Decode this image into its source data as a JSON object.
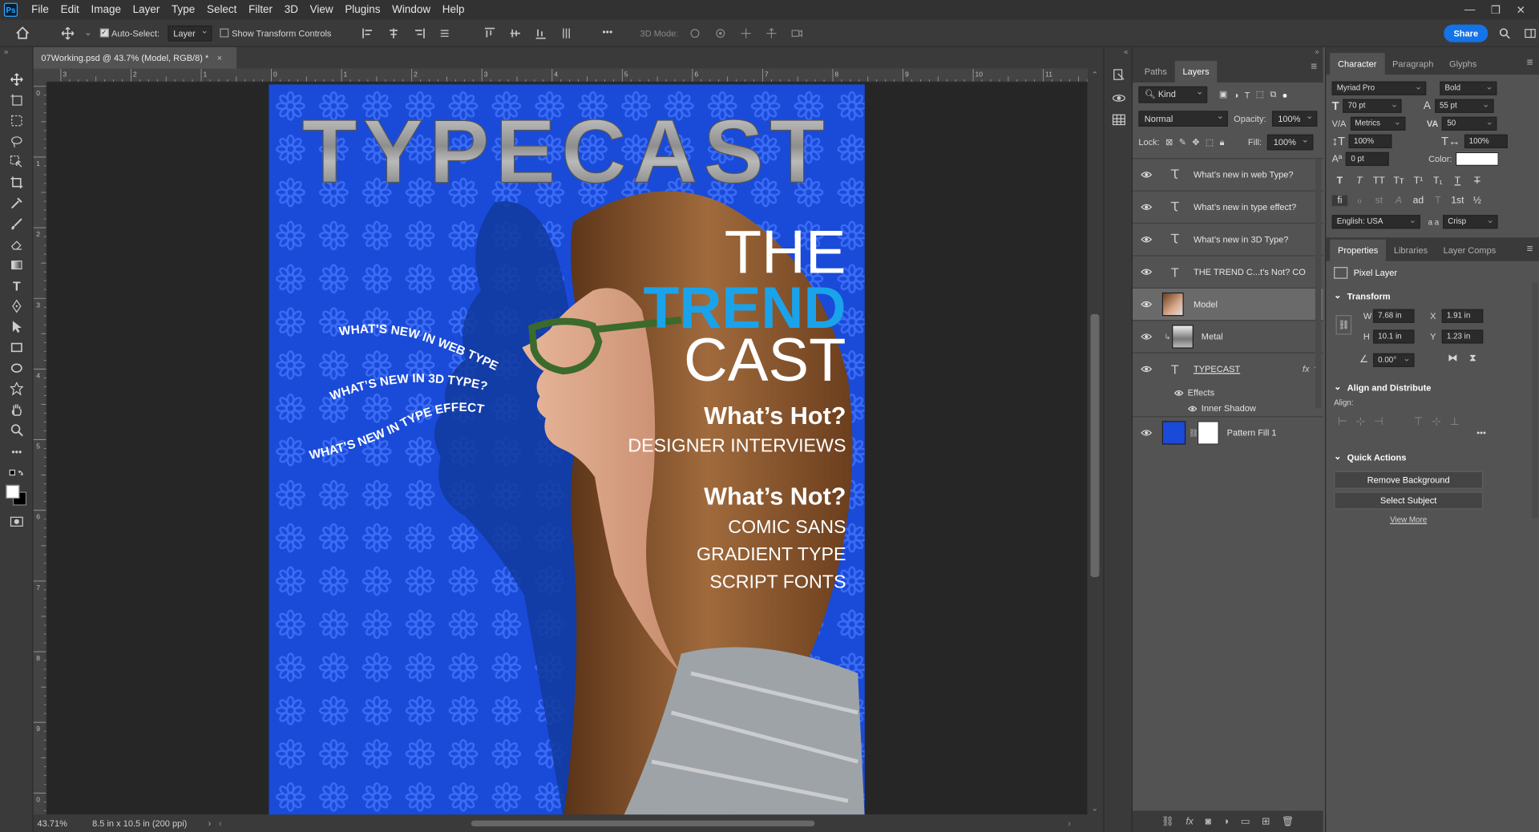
{
  "app": {
    "logo": "Ps",
    "menus": [
      "File",
      "Edit",
      "Image",
      "Layer",
      "Type",
      "Select",
      "Filter",
      "3D",
      "View",
      "Plugins",
      "Window",
      "Help"
    ]
  },
  "options": {
    "auto_select": "Auto-Select:",
    "auto_select_target": "Layer",
    "show_transform": "Show Transform Controls",
    "mode_3d": "3D Mode:",
    "share": "Share",
    "more": "•••"
  },
  "document": {
    "tab_title": "07Working.psd @ 43.7% (Model, RGB/8) *",
    "zoom": "43.71%",
    "doc_size": "8.5 in x 10.5 in (200 ppi)"
  },
  "rulers": {
    "h_ticks": [
      "3",
      "2",
      "1",
      "0",
      "1",
      "2",
      "3",
      "4",
      "5",
      "6",
      "7",
      "8",
      "9",
      "10",
      "11"
    ],
    "v_ticks": [
      "0",
      "1",
      "2",
      "3",
      "4",
      "5",
      "6",
      "7",
      "8",
      "9",
      "0"
    ]
  },
  "artwork": {
    "masthead": "TYPECAST",
    "headline_1": "THE",
    "headline_2": "TREND",
    "headline_3": "CAST",
    "hot_title": "What’s Hot?",
    "hot_item": "DESIGNER INTERVIEWS",
    "not_title": "What’s Not?",
    "not_items": [
      "COMIC SANS",
      "GRADIENT TYPE",
      "SCRIPT FONTS"
    ],
    "wave_texts": [
      "WHAT’S NEW IN WEB TYPE?",
      "WHAT’S NEW IN 3D TYPE?",
      "WHAT’S NEW IN TYPE EFFECT?"
    ],
    "bg_color": "#1a4ad8",
    "accent": "#1aa3ea"
  },
  "layers_panel": {
    "tabs": [
      "Paths",
      "Layers"
    ],
    "kind": "Kind",
    "blend": "Normal",
    "opacity_label": "Opacity:",
    "opacity": "100%",
    "lock_label": "Lock:",
    "fill_label": "Fill:",
    "fill": "100%",
    "layers": [
      {
        "name": "What’s new in web Type?",
        "type": "warp-text"
      },
      {
        "name": "What’s new in type effect?",
        "type": "warp-text"
      },
      {
        "name": "What’s new in 3D Type?",
        "type": "warp-text"
      },
      {
        "name": "THE TREND C...t’s Not? CO",
        "type": "text"
      },
      {
        "name": "Model",
        "type": "pixel",
        "selected": true
      },
      {
        "name": "Metal",
        "type": "pixel"
      },
      {
        "name": "TYPECAST",
        "type": "text",
        "fx": "fx"
      },
      {
        "name": "Pattern Fill 1",
        "type": "fill"
      }
    ],
    "effects_label": "Effects",
    "inner_shadow": "Inner Shadow"
  },
  "character": {
    "tabs": [
      "Character",
      "Paragraph",
      "Glyphs"
    ],
    "font": "Myriad Pro",
    "style": "Bold",
    "size": "70 pt",
    "leading": "55 pt",
    "kerning": "Metrics",
    "tracking": "50",
    "vscale": "100%",
    "hscale": "100%",
    "baseline": "0 pt",
    "color_label": "Color:",
    "color": "#ffffff",
    "language": "English: USA",
    "aa_label": "a a",
    "aa": "Crisp",
    "style_glyphs": [
      "T",
      "T",
      "TT",
      "Tт",
      "T¹",
      "T₁",
      "T",
      "T"
    ],
    "ot_glyphs": [
      "fi",
      "ℴ",
      "st",
      "A",
      "ad",
      "T",
      "1st",
      "½"
    ]
  },
  "properties": {
    "tabs": [
      "Properties",
      "Libraries",
      "Layer Comps"
    ],
    "layer_kind": "Pixel Layer",
    "transform": {
      "title": "Transform",
      "w_label": "W",
      "w": "7.68 in",
      "x_label": "X",
      "x": "1.91 in",
      "h_label": "H",
      "h": "10.1 in",
      "y_label": "Y",
      "y": "1.23 in",
      "angle": "0.00°"
    },
    "align": {
      "title": "Align and Distribute",
      "label": "Align:",
      "more": "•••"
    },
    "quick": {
      "title": "Quick Actions",
      "remove_bg": "Remove Background",
      "select_subject": "Select Subject",
      "view_more": "View More"
    }
  }
}
